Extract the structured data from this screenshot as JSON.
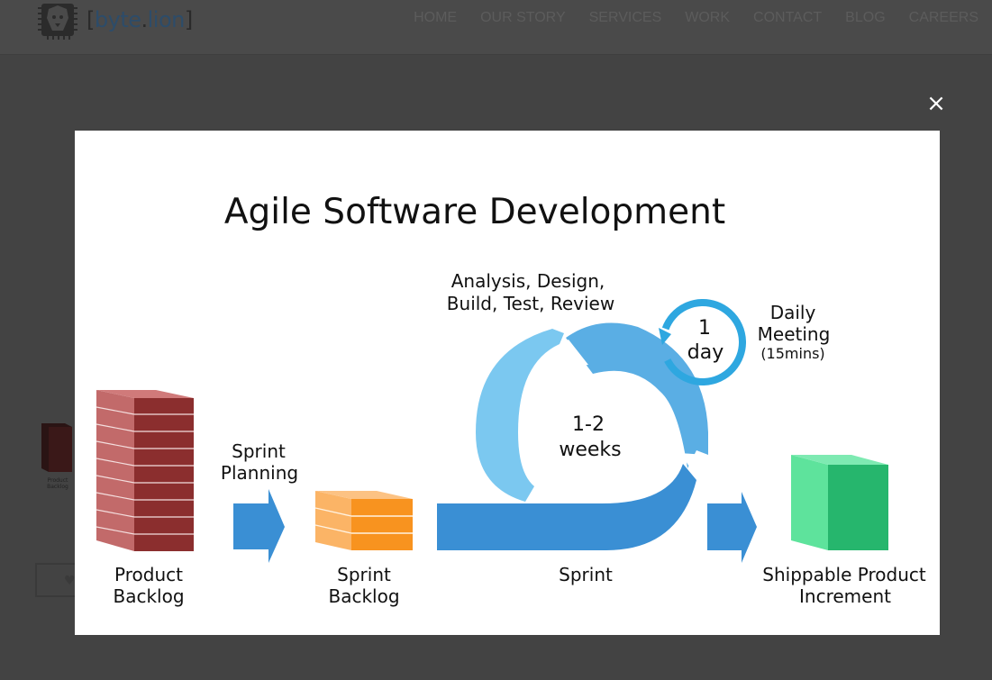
{
  "header": {
    "logo_bracket_open": "[",
    "logo_brand": "byte",
    "logo_dot": ".",
    "logo_word": "lion",
    "logo_bracket_close": "]",
    "nav": [
      "HOME",
      "OUR STORY",
      "SERVICES",
      "WORK",
      "CONTACT",
      "BLOG",
      "CAREERS"
    ]
  },
  "background": {
    "thumb_label_1": "Product",
    "thumb_label_2": "Backlog"
  },
  "lightbox": {
    "close_label": "×",
    "title": "Agile Software Development",
    "activities_line1": "Analysis, Design,",
    "activities_line2": "Build, Test, Review",
    "daily_line1": "1",
    "daily_line2": "day",
    "daily_meeting_line1": "Daily",
    "daily_meeting_line2": "Meeting",
    "daily_meeting_duration": "(15mins)",
    "cycle_line1": "1-2",
    "cycle_line2": "weeks",
    "sprint_planning_line1": "Sprint",
    "sprint_planning_line2": "Planning",
    "product_backlog_line1": "Product",
    "product_backlog_line2": "Backlog",
    "sprint_backlog_line1": "Sprint",
    "sprint_backlog_line2": "Backlog",
    "sprint": "Sprint",
    "increment_line1": "Shippable Product",
    "increment_line2": "Increment"
  },
  "colors": {
    "overlay": "#434343",
    "backlog_red": "#8b2e2e",
    "sprint_orange": "#f89a2c",
    "sprint_blue": "#3a8fd4",
    "cycle_light_blue": "#7bc8f0",
    "daily_blue": "#2ea7e0",
    "increment_green": "#35d07f"
  }
}
